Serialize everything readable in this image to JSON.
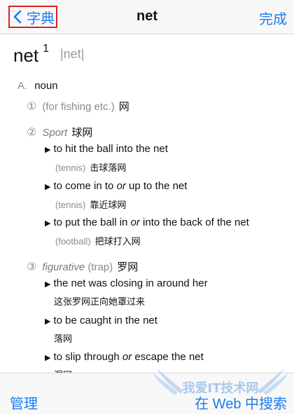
{
  "nav": {
    "back_label": "字典",
    "title": "net",
    "done_label": "完成"
  },
  "entry": {
    "headword": "net",
    "sup": "1",
    "pronunciation": "|net|",
    "pos_letter": "A.",
    "pos": "noun",
    "senses": [
      {
        "num": "①",
        "label": "(for fishing etc.)",
        "cn": "网"
      },
      {
        "num": "②",
        "label": "Sport",
        "cn": "球网",
        "examples": [
          {
            "en_1": "to hit the ball into the net",
            "tag": "(tennis)",
            "cn": "击球落网"
          },
          {
            "en_1": "to come in to ",
            "en_or": "or",
            "en_2": " up to the net",
            "tag": "(tennis)",
            "cn": "靠近球网"
          },
          {
            "en_1": "to put the ball in ",
            "en_or": "or",
            "en_2": " into the back of the net",
            "tag": "(football)",
            "cn": "把球打入网"
          }
        ]
      },
      {
        "num": "③",
        "label": "figurative",
        "label2": "(trap)",
        "cn": "罗网",
        "examples": [
          {
            "en_1": "the net was closing in around her",
            "cn": "这张罗网正向她罩过来"
          },
          {
            "en_1": "to be caught in the net",
            "cn": "落网"
          },
          {
            "en_1": "to slip through ",
            "en_or": "or",
            "en_2": " escape the net",
            "cn": "漏网"
          }
        ]
      }
    ]
  },
  "toolbar": {
    "manage_label": "管理",
    "web_search_label": "在 Web 中搜索"
  },
  "watermark": {
    "text": "我爱IT技术网"
  },
  "colors": {
    "accent": "#1a7cf3",
    "highlight_box": "#e02020"
  }
}
